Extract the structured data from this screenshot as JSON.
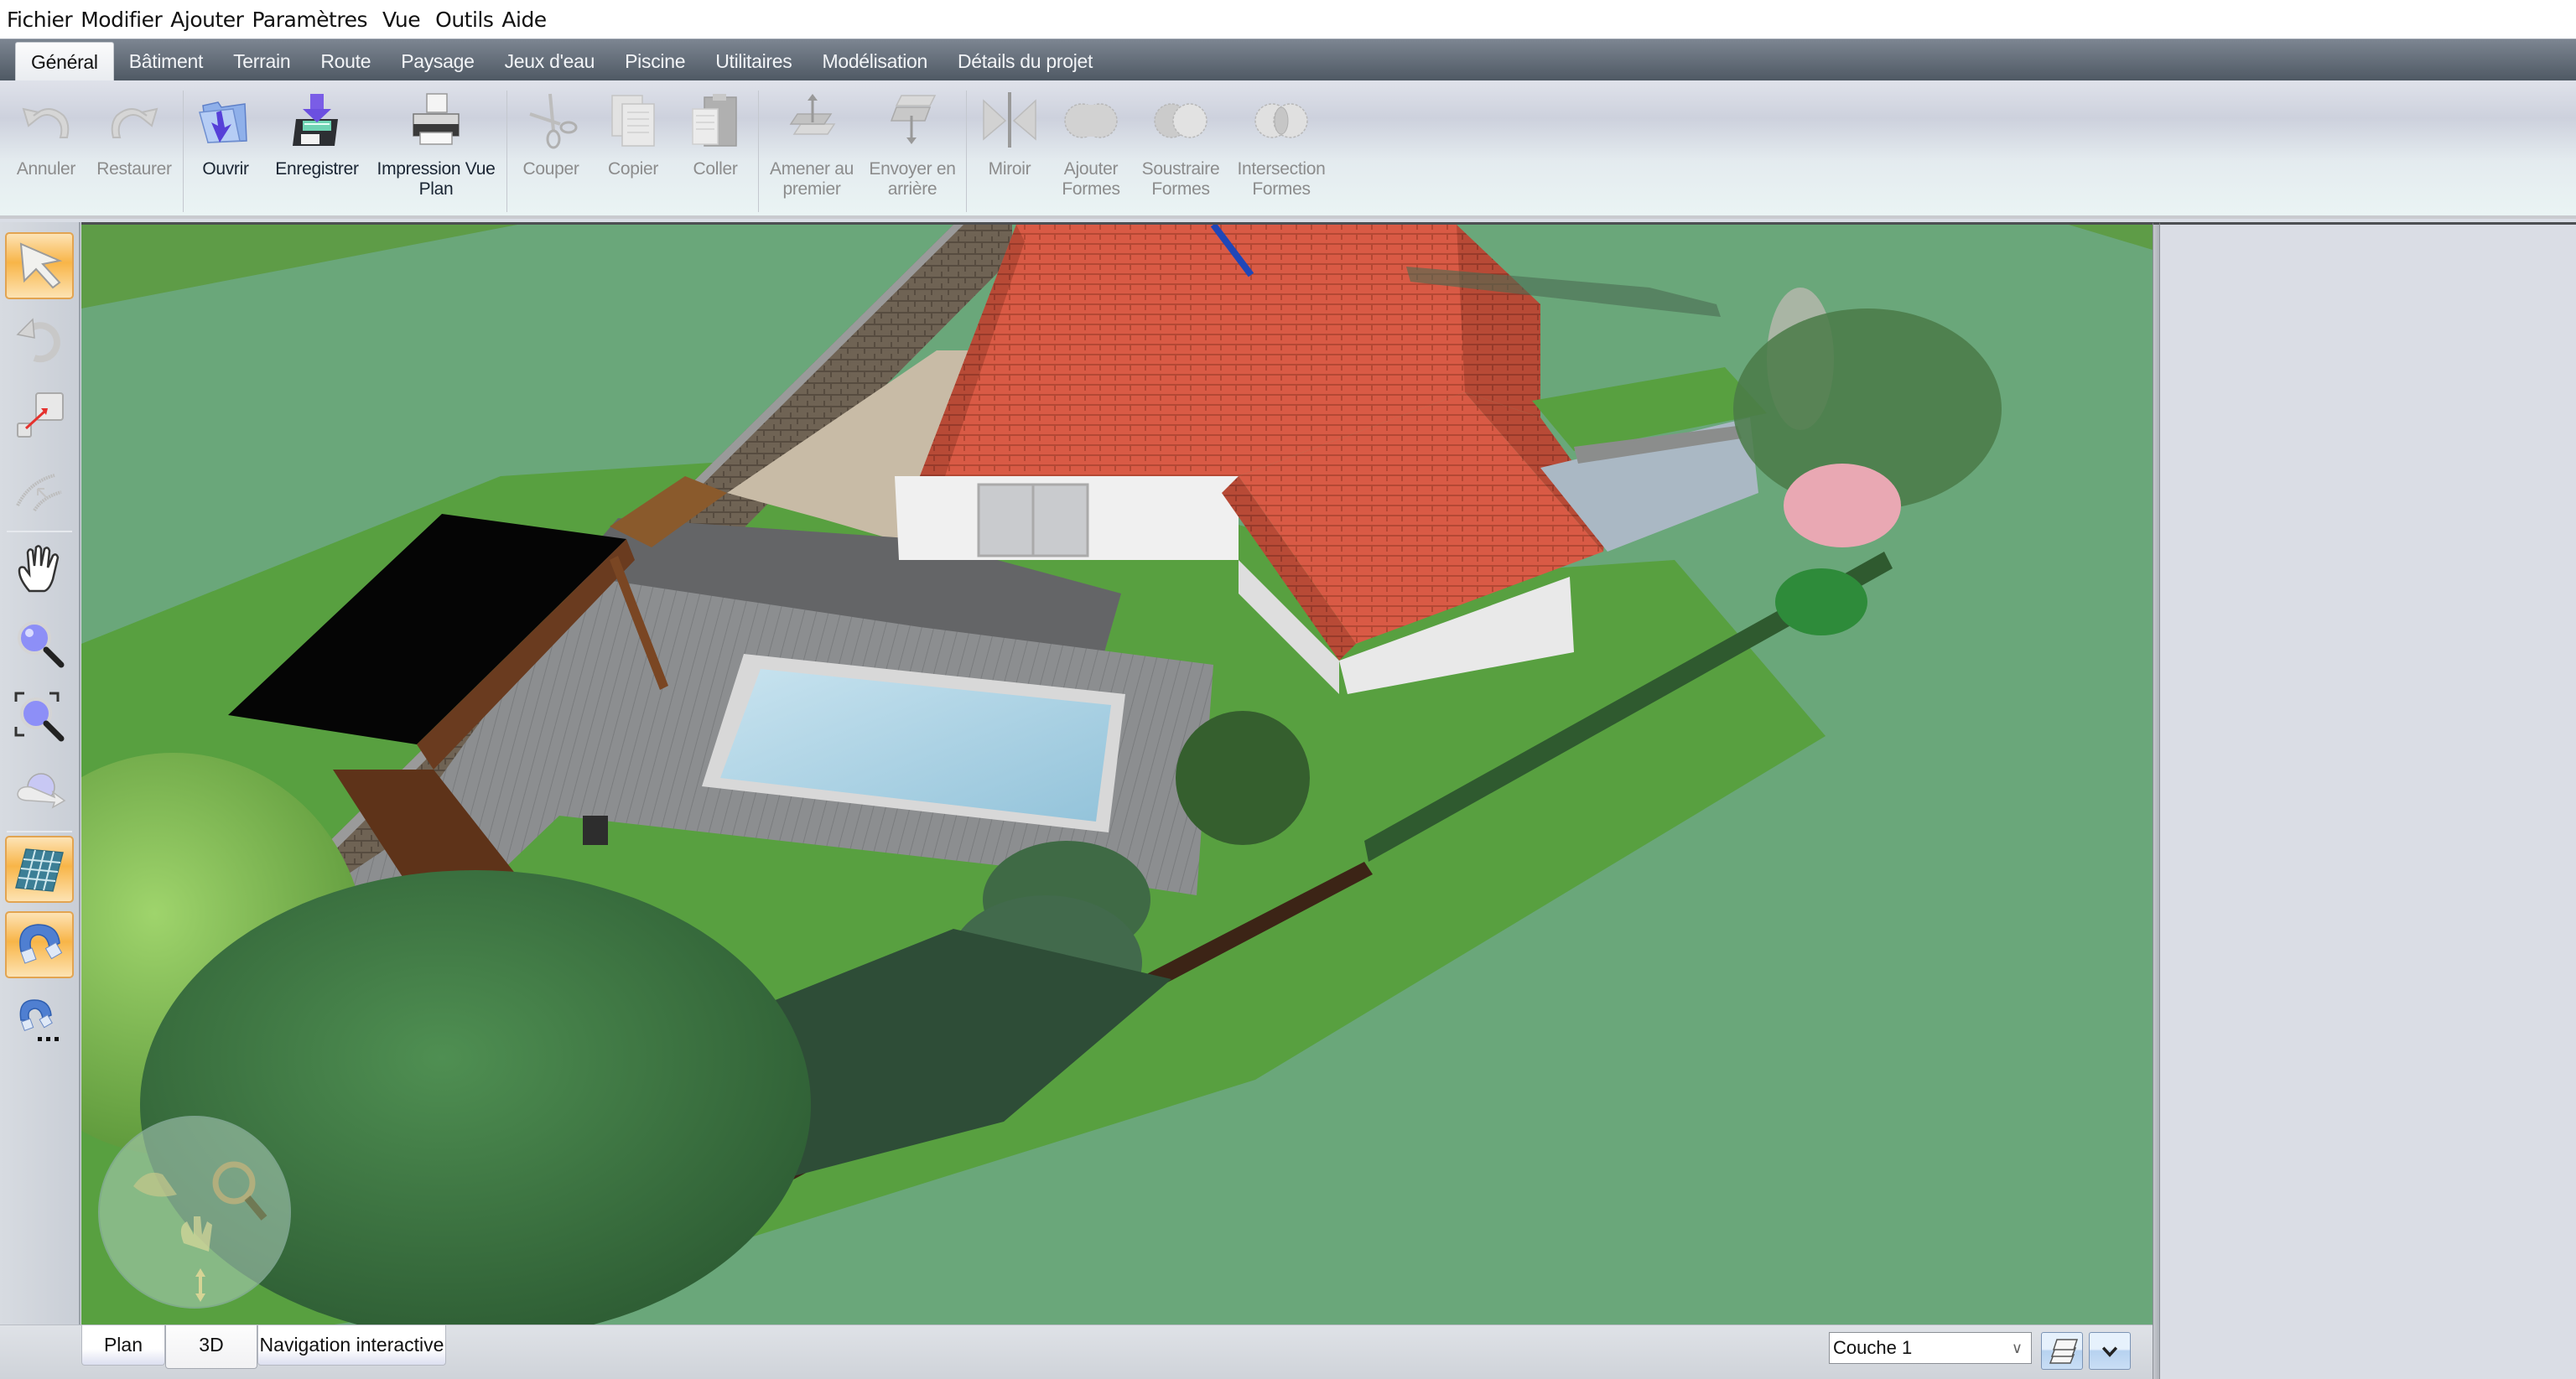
{
  "menubar": {
    "items": [
      "Fichier",
      "Modifier",
      "Ajouter",
      "Paramètres",
      "Vue",
      "Outils",
      "Aide"
    ]
  },
  "ribbon_tabs": {
    "items": [
      "Général",
      "Bâtiment",
      "Terrain",
      "Route",
      "Paysage",
      "Jeux d'eau",
      "Piscine",
      "Utilitaires",
      "Modélisation",
      "Détails du projet"
    ],
    "active": "Général"
  },
  "ribbon": {
    "undo": {
      "label": "Annuler",
      "icon": "undo-icon",
      "enabled": false
    },
    "redo": {
      "label": "Restaurer",
      "icon": "redo-icon",
      "enabled": false
    },
    "open": {
      "label": "Ouvrir",
      "icon": "open-folder-icon",
      "enabled": true
    },
    "save": {
      "label": "Enregistrer",
      "icon": "save-disk-icon",
      "enabled": true
    },
    "print": {
      "label": "Impression Vue Plan",
      "icon": "printer-icon",
      "enabled": true
    },
    "cut": {
      "label": "Couper",
      "icon": "scissors-icon",
      "enabled": false
    },
    "copy": {
      "label": "Copier",
      "icon": "copy-icon",
      "enabled": false
    },
    "paste": {
      "label": "Coller",
      "icon": "clipboard-icon",
      "enabled": false
    },
    "bring_front": {
      "label": "Amener au premier",
      "icon": "bring-to-front-icon",
      "enabled": false
    },
    "send_back": {
      "label": "Envoyer en arrière",
      "icon": "send-to-back-icon",
      "enabled": false
    },
    "mirror": {
      "label": "Miroir",
      "icon": "mirror-icon",
      "enabled": false
    },
    "union": {
      "label": "Ajouter Formes",
      "icon": "shape-union-icon",
      "enabled": false
    },
    "subtract": {
      "label": "Soustraire Formes",
      "icon": "shape-subtract-icon",
      "enabled": false
    },
    "intersect": {
      "label": "Intersection Formes",
      "icon": "shape-intersect-icon",
      "enabled": false
    }
  },
  "left_toolbar": {
    "tools": [
      {
        "name": "select",
        "icon": "select-arrow-icon",
        "active": true
      },
      {
        "name": "rotate",
        "icon": "rotate-icon",
        "active": false
      },
      {
        "name": "move-resize",
        "icon": "move-resize-icon",
        "active": false
      },
      {
        "name": "arc-edit",
        "icon": "arc-edit-icon",
        "active": false
      },
      {
        "name": "pan",
        "icon": "hand-pan-icon",
        "active": false
      },
      {
        "name": "zoom",
        "icon": "zoom-icon",
        "active": false
      },
      {
        "name": "zoom-extents",
        "icon": "zoom-extents-icon",
        "active": false
      },
      {
        "name": "orbit",
        "icon": "orbit-icon",
        "active": false
      },
      {
        "name": "grid",
        "icon": "grid-icon",
        "active": true
      },
      {
        "name": "snap",
        "icon": "magnet-snap-icon",
        "active": true
      },
      {
        "name": "snap-settings",
        "icon": "magnet-settings-icon",
        "active": false
      }
    ]
  },
  "bottom_bar": {
    "view_tabs": [
      "Plan",
      "3D",
      "Navigation interactive"
    ],
    "active_view": "3D",
    "layer_select": {
      "value": "Couche 1"
    },
    "layers_button_icon": "layers-icon",
    "expand_button_icon": "chevron-down-icon"
  },
  "colors": {
    "accent_active": "#f8b548",
    "ribbon_tab_bg": "#5f6873",
    "roof": "#d9553f",
    "grass": "#5fa46a",
    "water": "#a7cfe2"
  }
}
